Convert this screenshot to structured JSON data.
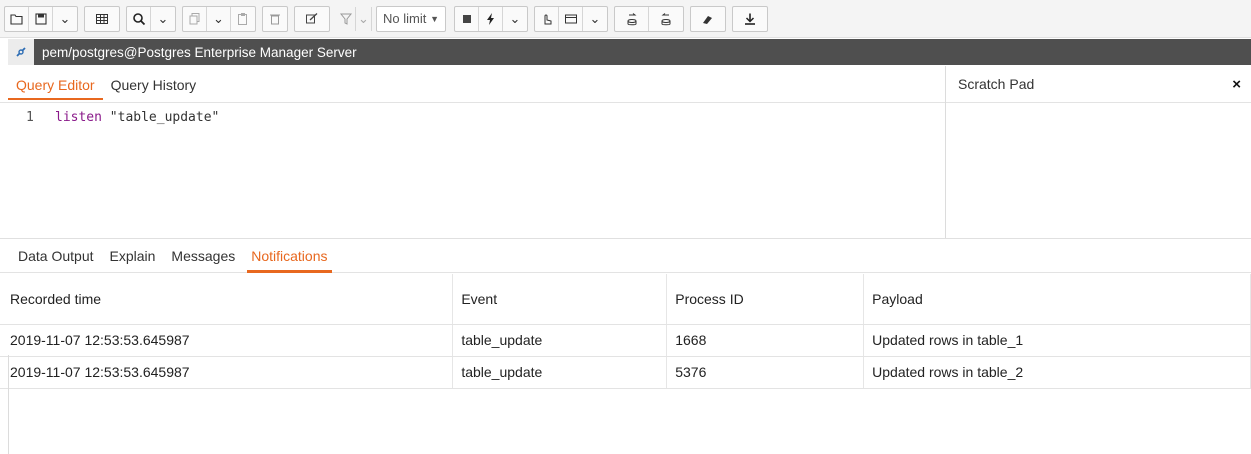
{
  "toolbar": {
    "limit_label": "No limit",
    "icons": [
      "open-file-icon",
      "save-icon",
      "chevron-down-icon",
      "table-view-icon",
      "find-icon",
      "chevron-down-icon",
      "copy-icon",
      "chevron-down-icon",
      "paste-icon",
      "delete-icon",
      "edit-icon",
      "filter-icon",
      "chevron-down-icon",
      "stop-icon",
      "execute-icon",
      "chevron-down-icon",
      "explain-icon",
      "macro-icon",
      "chevron-down-icon",
      "commit-icon",
      "rollback-icon",
      "clear-icon",
      "download-icon"
    ]
  },
  "connection": {
    "label": "pem/postgres@Postgres Enterprise Manager Server"
  },
  "editor": {
    "tabs": [
      "Query Editor",
      "Query History"
    ],
    "active_tab": "Query Editor",
    "line_number": "1",
    "code_keyword": "listen",
    "code_rest": " \"table_update\""
  },
  "scratch_pad": {
    "title": "Scratch Pad",
    "close": "×"
  },
  "output": {
    "tabs": [
      "Data Output",
      "Explain",
      "Messages",
      "Notifications"
    ],
    "active_tab": "Notifications",
    "columns": [
      "Recorded time",
      "Event",
      "Process ID",
      "Payload"
    ],
    "rows": [
      [
        "2019-11-07 12:53:53.645987",
        "table_update",
        "1668",
        "Updated rows in table_1"
      ],
      [
        "2019-11-07 12:53:53.645987",
        "table_update",
        "5376",
        "Updated rows in table_2"
      ]
    ]
  },
  "colors": {
    "accent": "#e8681f",
    "connection_bar": "#4f4f4f",
    "keyword": "#8a1a8a"
  }
}
